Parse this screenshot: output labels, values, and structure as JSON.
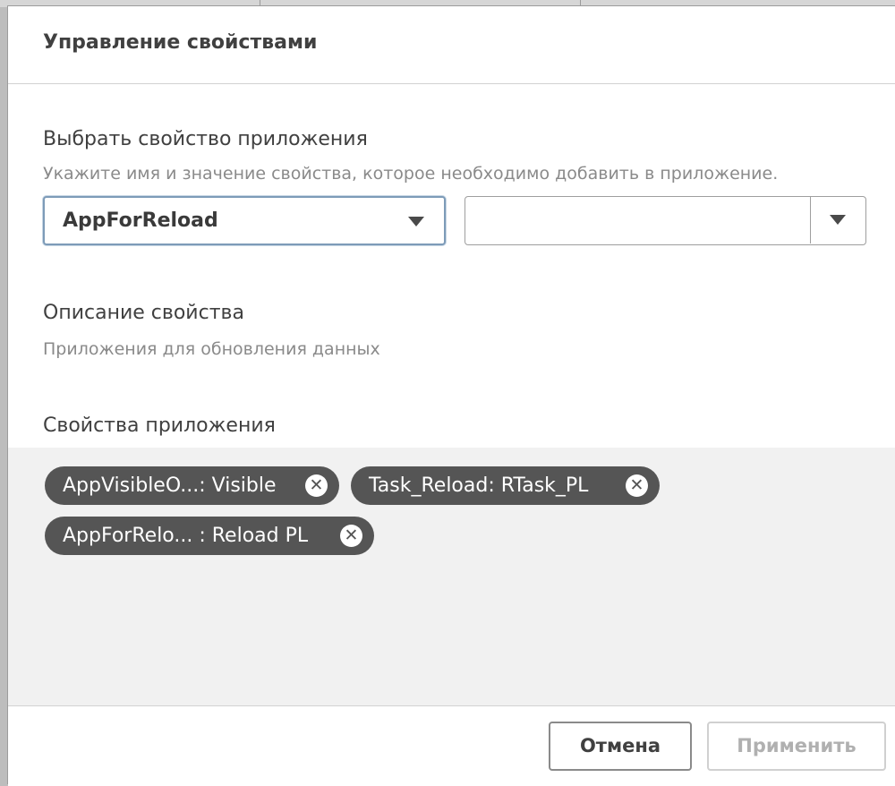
{
  "dialog": {
    "title": "Управление свойствами",
    "select_property": {
      "label": "Выбрать свойство приложения",
      "hint": "Укажите имя и значение свойства, которое необходимо добавить в приложение.",
      "name_value": "AppForReload",
      "value_input": ""
    },
    "description": {
      "label": "Описание свойства",
      "text": "Приложения для обновления данных"
    },
    "app_properties": {
      "label": "Свойства приложения",
      "chips": [
        {
          "label": "AppVisibleO...: Visible"
        },
        {
          "label": "Task_Reload: RTask_PL"
        },
        {
          "label": "AppForRelo... : Reload PL"
        }
      ]
    },
    "footer": {
      "cancel_label": "Отмена",
      "apply_label": "Применить"
    }
  },
  "colors": {
    "chip_bg": "#555555",
    "chip_area_bg": "#f1f1f1",
    "focus_border": "#7d9bb8"
  }
}
